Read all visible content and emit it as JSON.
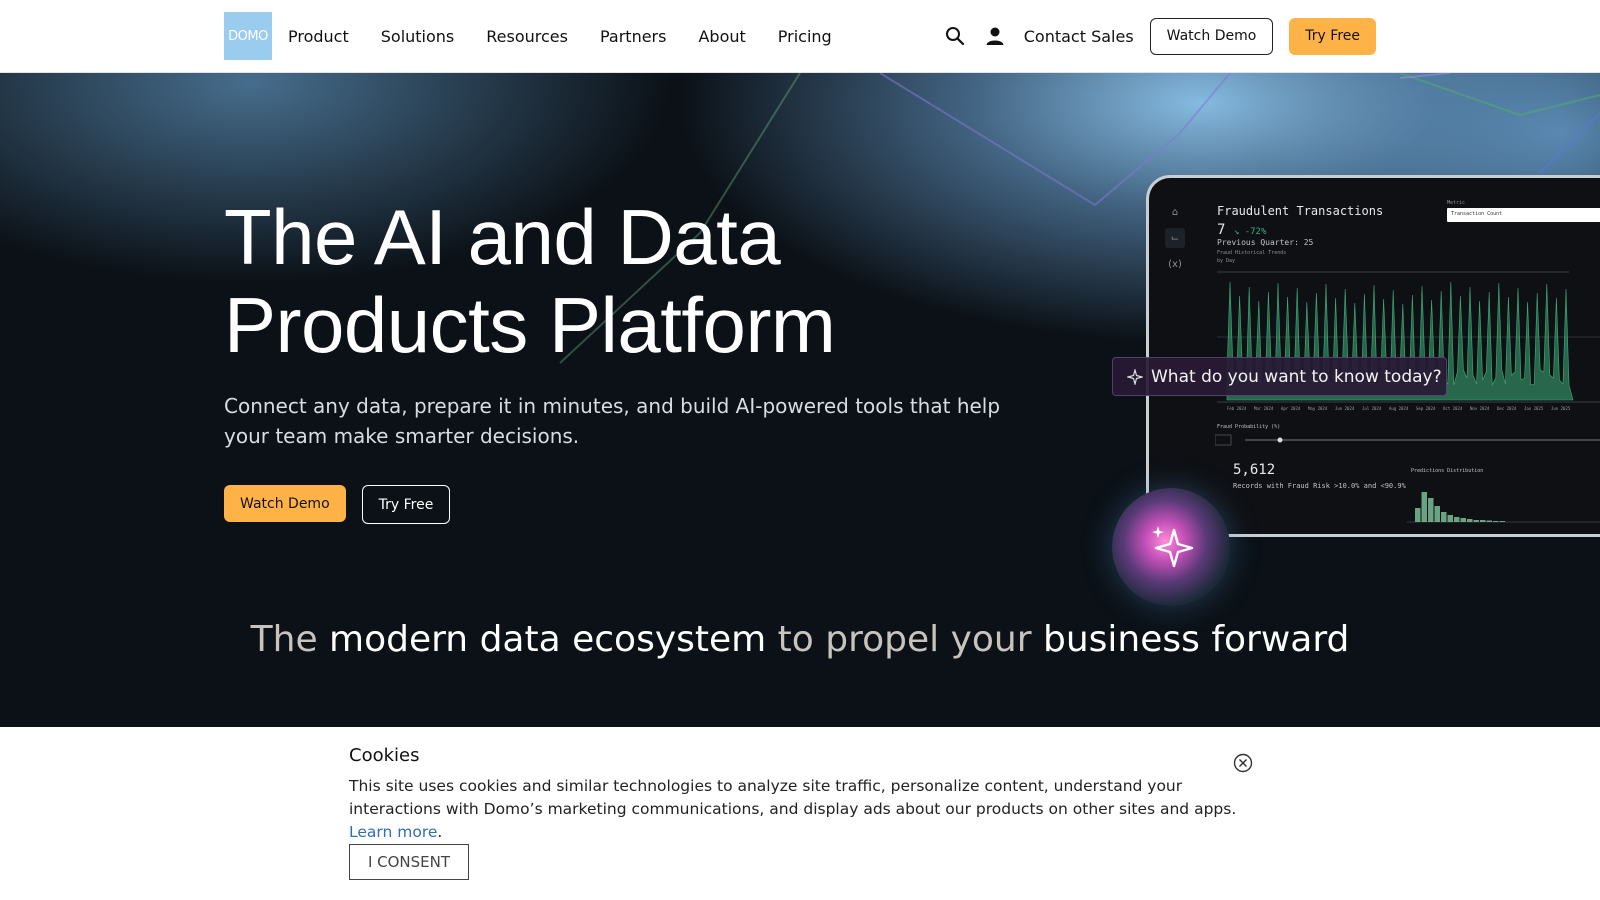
{
  "header": {
    "logo_text": "DOMO",
    "nav": [
      "Product",
      "Solutions",
      "Resources",
      "Partners",
      "About",
      "Pricing"
    ],
    "search_icon": "search-icon",
    "user_icon": "user-icon",
    "contact_label": "Contact Sales",
    "watch_demo_label": "Watch Demo",
    "try_free_label": "Try Free"
  },
  "hero": {
    "title_line1": "The AI and Data",
    "title_line2": "Products Platform",
    "subtitle": "Connect any data, prepare it in minutes, and build AI-powered tools that help your team make smarter decisions.",
    "watch_demo_label": "Watch Demo",
    "try_free_label": "Try Free",
    "tagline": {
      "part1": "The ",
      "part2": "modern data ecosystem",
      "part3": " to propel your ",
      "part4": "business forward"
    }
  },
  "dashboard": {
    "title": "Fraudulent Transactions",
    "value": "7",
    "change": "↘ -72%",
    "previous": "Previous Quarter: 25",
    "trend_label": "Fraud Historical Trends",
    "trend_sublabel": "by Day",
    "metric_label": "Metric",
    "metric_value": "Transaction Count",
    "ai_prompt": "What do you want to know today?",
    "prob_label": "Fraud Probability (%)",
    "count": "5,612",
    "count_desc": "Records with Fraud Risk >10.0% and <90.9%",
    "dist_label": "Predictions Distribution",
    "x_labels": [
      "Feb 2024",
      "Mar 2024",
      "Apr 2024",
      "May 2024",
      "Jun 2024",
      "Jul 2024",
      "Aug 2024",
      "Sep 2024",
      "Oct 2024",
      "Nov 2024",
      "Dec 2024",
      "Jan 2025",
      "Jun 2025"
    ]
  },
  "cookie": {
    "title": "Cookies",
    "text": "This site uses cookies and similar technologies to analyze site traffic, personalize content, understand your interactions with Domo’s marketing communications, and display ads about our products on other sites and apps. ",
    "link": "Learn more",
    "period": ".",
    "consent_label": "I CONSENT",
    "close_icon": "close-circle-icon"
  },
  "colors": {
    "accent_orange": "#ffb347",
    "logo_blue": "#99ccee",
    "chart_green": "#3fae7a",
    "link_blue": "#2f6fb3"
  }
}
